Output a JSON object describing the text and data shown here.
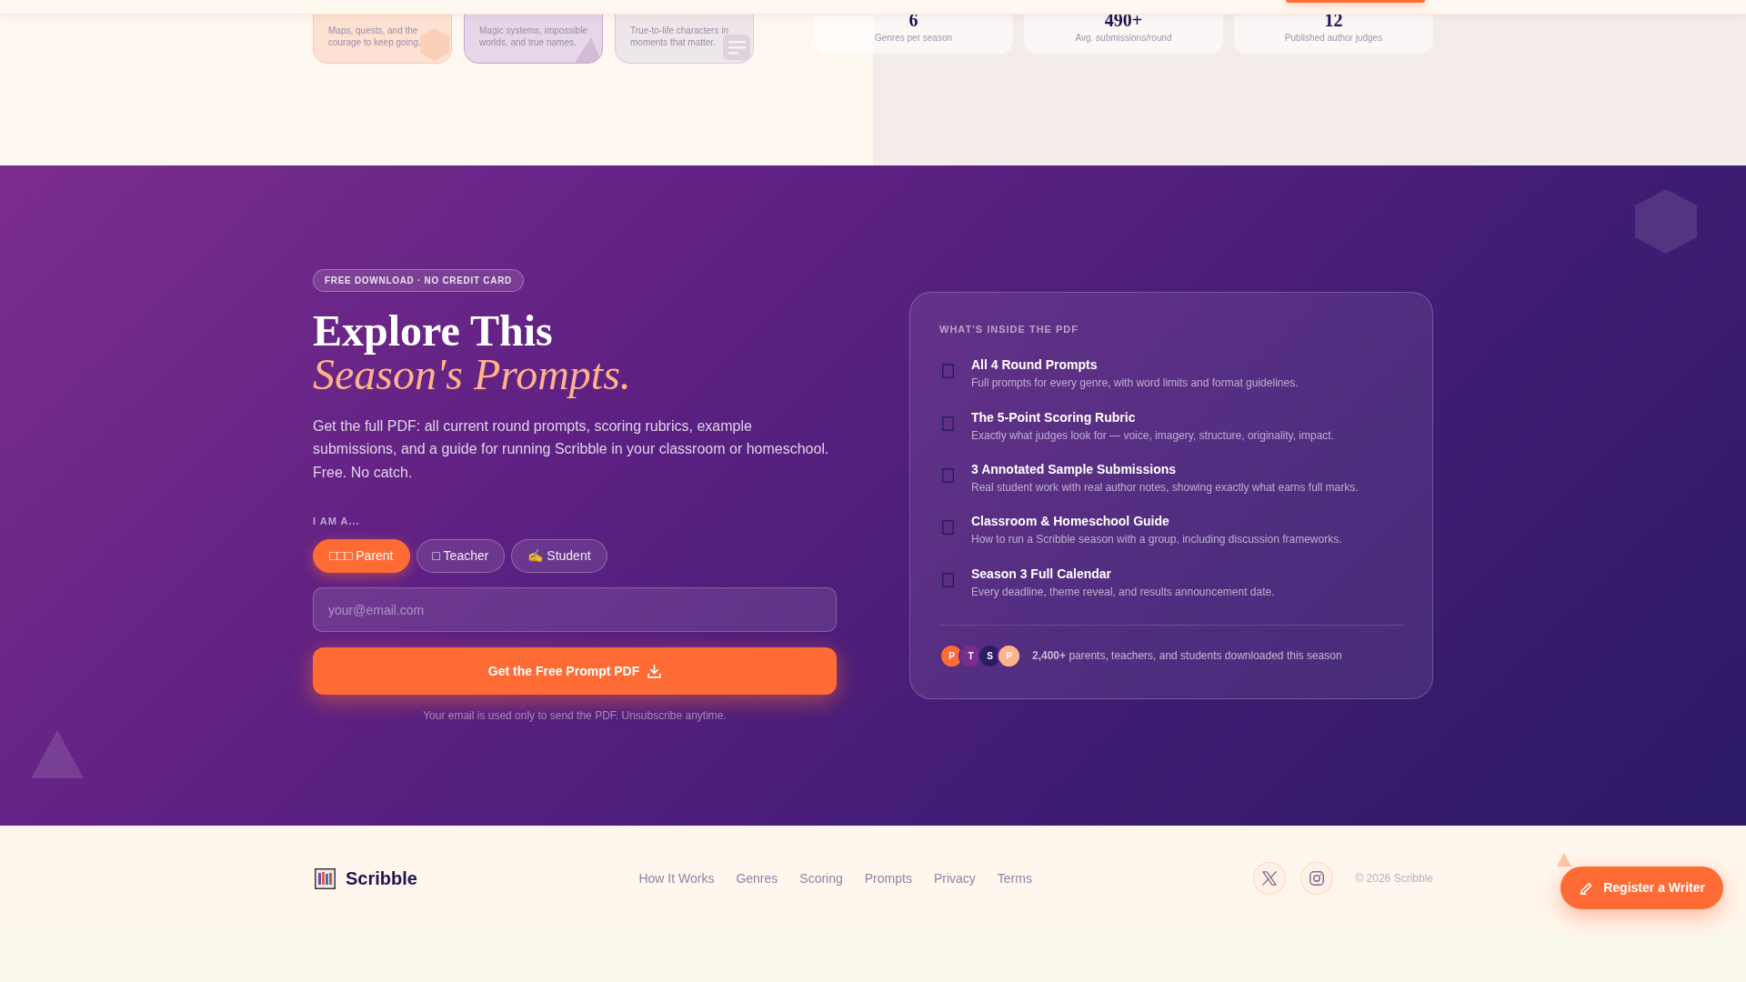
{
  "genre_cards": [
    {
      "description": "Maps, quests, and the courage to keep going.",
      "color": "#fde2d3"
    },
    {
      "description": "Magic systems, impossible worlds, and true names.",
      "color": "#e5d7e7"
    },
    {
      "description": "True-to-life characters in moments that matter.",
      "color": "#eee7ea"
    }
  ],
  "stats": [
    {
      "value": "6",
      "label": "Genres per season"
    },
    {
      "value": "490+",
      "label": "Avg. submissions/round"
    },
    {
      "value": "12",
      "label": "Published author judges"
    }
  ],
  "download": {
    "badge": "FREE DOWNLOAD · NO CREDIT CARD",
    "heading": "Explore This",
    "heading_accent": "Season's Prompts.",
    "description": "Get the full PDF: all current round prompts, scoring rubrics, example submissions, and a guide for running Scribble in your classroom or homeschool. Free. No catch.",
    "role_label": "I AM A...",
    "roles": [
      {
        "label": "□□□ Parent",
        "selected": true
      },
      {
        "label": "□ Teacher",
        "selected": false
      },
      {
        "label": "✍ Student",
        "selected": false
      }
    ],
    "email": {
      "placeholder": "your@email.com"
    },
    "submit": "Get the Free Prompt PDF",
    "note": "Your email is used only to send the PDF. Unsubscribe anytime."
  },
  "pdf_contents": {
    "title": "WHAT'S INSIDE THE PDF",
    "items": [
      {
        "title": "All 4 Round Prompts",
        "description": "Full prompts for every genre, with word limits and format guidelines."
      },
      {
        "title": "The 5-Point Scoring Rubric",
        "description": "Exactly what judges look for — voice, imagery, structure, originality, impact."
      },
      {
        "title": "3 Annotated Sample Submissions",
        "description": "Real student work with real author notes, showing exactly what earns full marks."
      },
      {
        "title": "Classroom & Homeschool Guide",
        "description": "How to run a Scribble season with a group, including discussion frameworks."
      },
      {
        "title": "Season 3 Full Calendar",
        "description": "Every deadline, theme reveal, and results announcement date."
      }
    ],
    "avatars": [
      {
        "initial": "P",
        "color": "#ff6b35"
      },
      {
        "initial": "T",
        "color": "#7b2d8e"
      },
      {
        "initial": "S",
        "color": "#2d1b69"
      },
      {
        "initial": "P",
        "color": "#ffb38a"
      }
    ],
    "social_proof": "**2,400+** parents, teachers, and students downloaded this season"
  },
  "footer": {
    "brand": "Scribble",
    "links": [
      "How It Works",
      "Genres",
      "Scoring",
      "Prompts",
      "Privacy",
      "Terms"
    ],
    "copyright": "© 2026 Scribble"
  },
  "floating_button": {
    "label": "Register a Writer"
  }
}
